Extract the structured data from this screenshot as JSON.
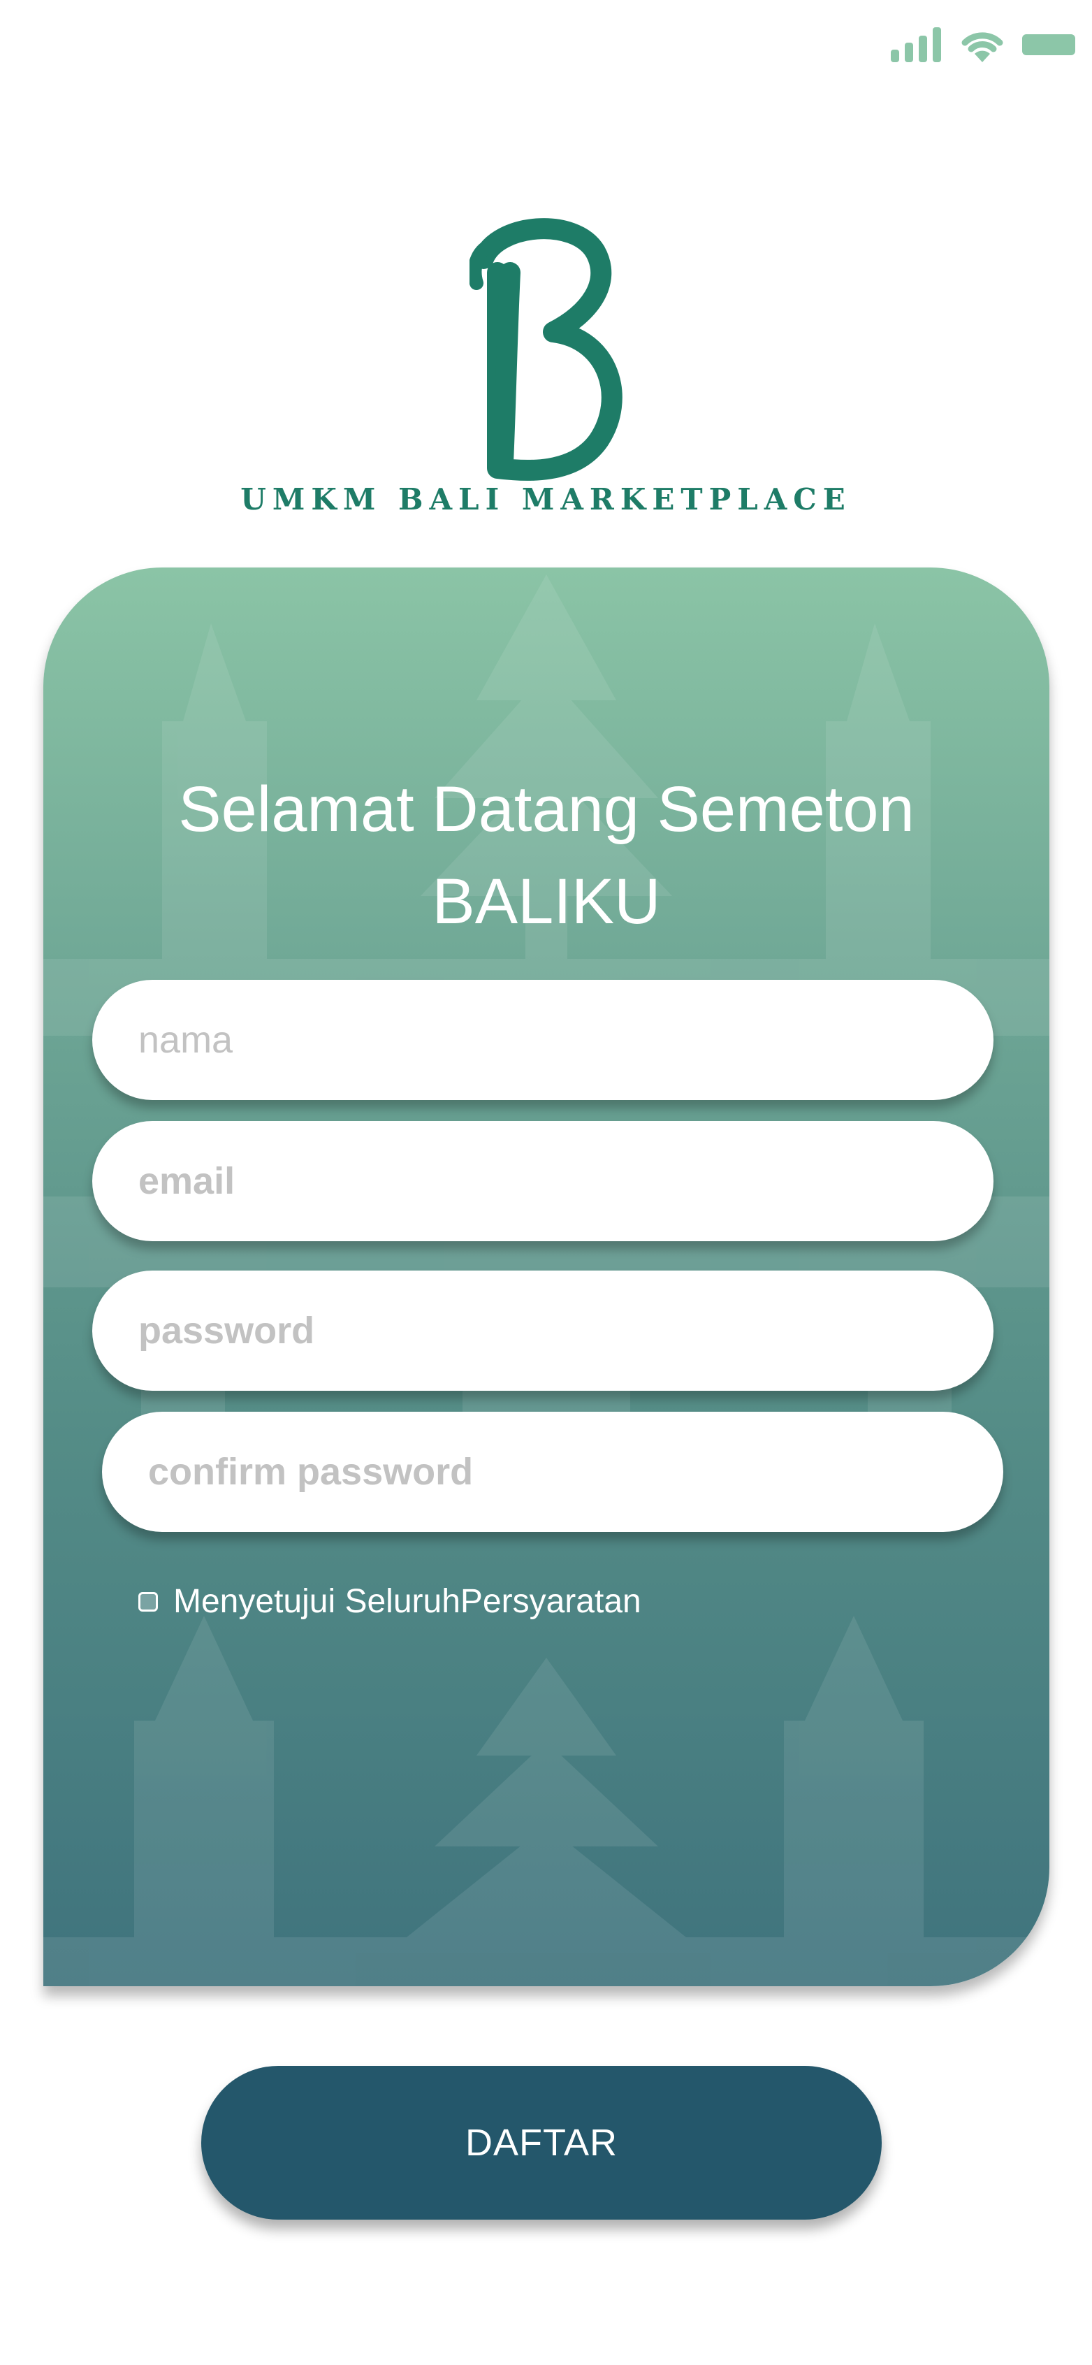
{
  "status_bar": {
    "signal_icon": "cellular-signal-icon",
    "wifi_icon": "wifi-icon",
    "battery_icon": "battery-icon"
  },
  "logo": {
    "mark_letter": "B",
    "brand_name": "UMKM BALI MARKETPLACE",
    "color": "#1e7c67"
  },
  "card": {
    "title_line1": "Selamat Datang Semeton",
    "title_line2": "BALIKU",
    "gradient_top": "#8bc4a6",
    "gradient_bottom": "#3f737d"
  },
  "form": {
    "name_placeholder": "nama",
    "email_placeholder": "email",
    "password_placeholder": "password",
    "confirm_password_placeholder": "confirm password",
    "agree_label": "Menyetujui SeluruhPersyaratan",
    "agree_checked": false
  },
  "submit": {
    "label": "DAFTAR",
    "color": "#24576b"
  }
}
